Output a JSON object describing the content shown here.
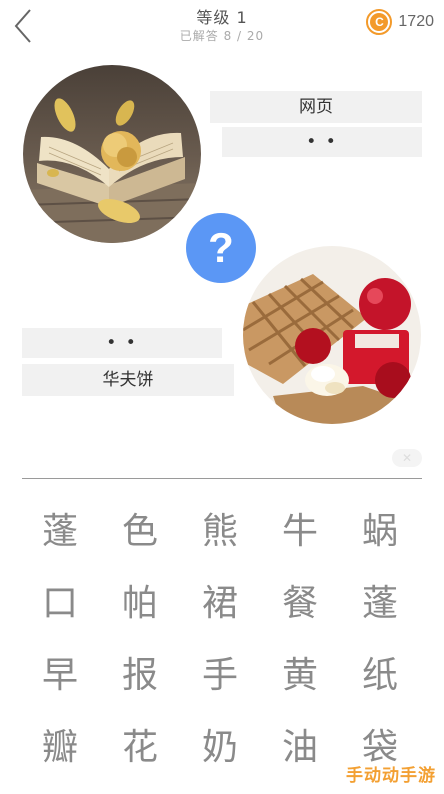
{
  "header": {
    "title": "等级 1",
    "subtitle": "已解答 8 / 20",
    "coins": "1720",
    "coin_symbol": "C"
  },
  "puzzle": {
    "top_word": "网页",
    "top_blanks": "• •",
    "bottom_blanks": "• •",
    "bottom_word": "华夫饼",
    "question_mark": "?",
    "clear_symbol": "✕"
  },
  "keyboard": [
    "蓬",
    "色",
    "熊",
    "牛",
    "蜗",
    "口",
    "帕",
    "裙",
    "餐",
    "蓬",
    "早",
    "报",
    "手",
    "黄",
    "纸",
    "瓣",
    "花",
    "奶",
    "油",
    "袋"
  ],
  "watermark": "手动动手游"
}
